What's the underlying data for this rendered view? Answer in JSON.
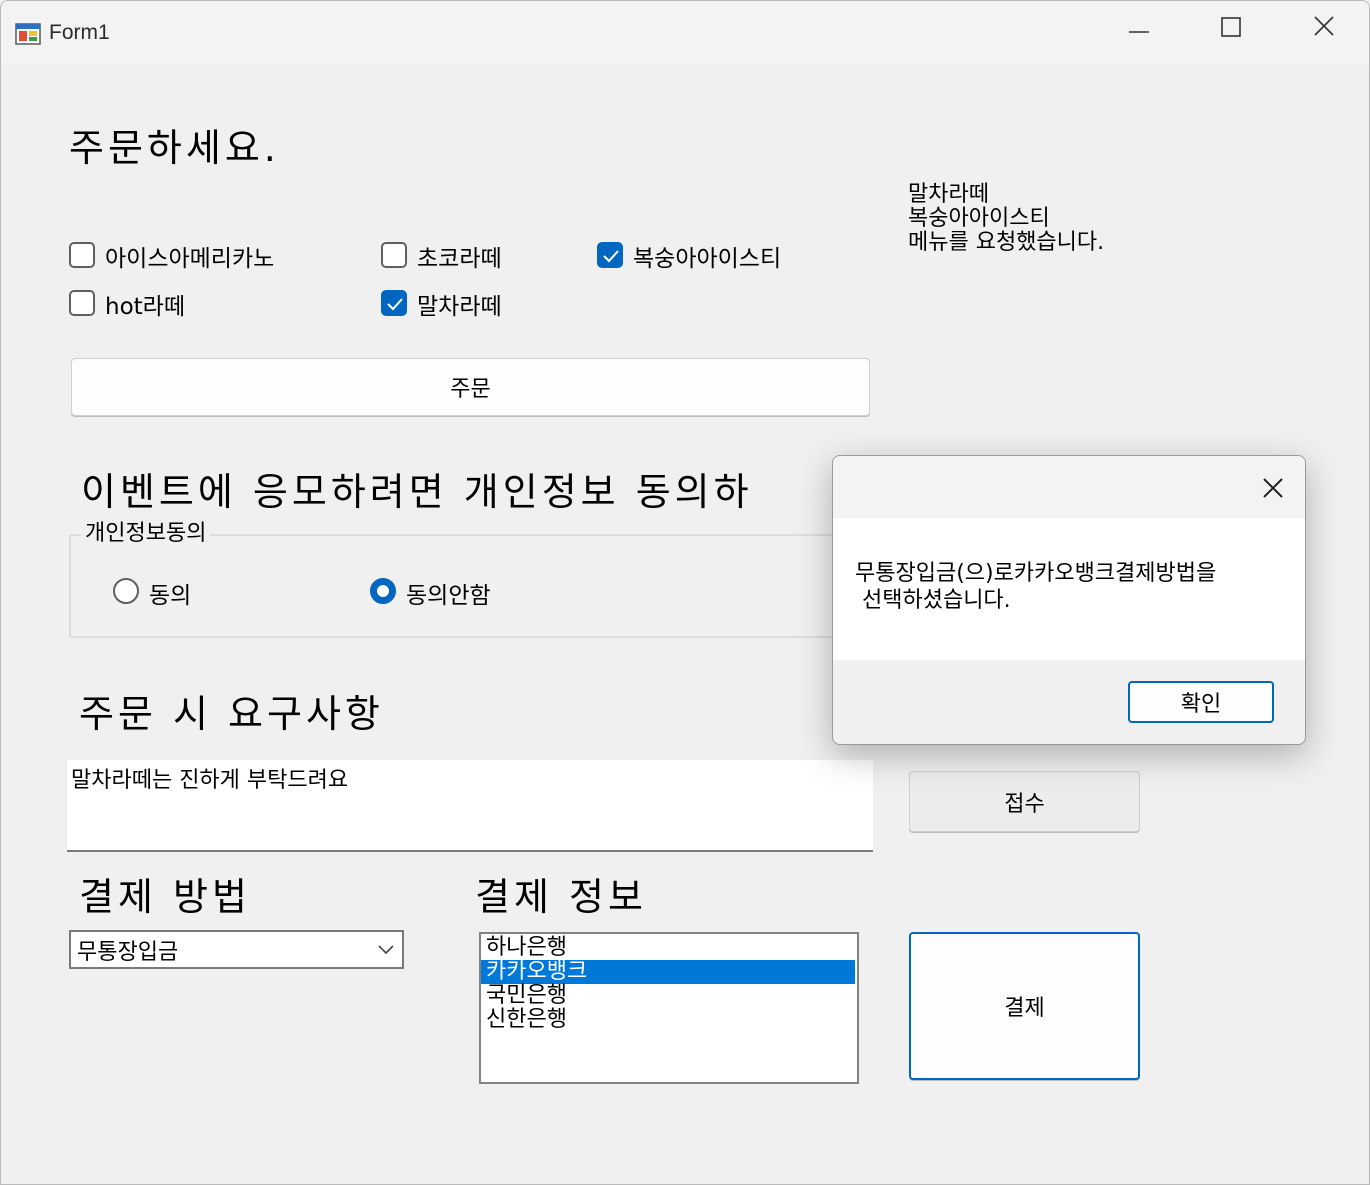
{
  "window": {
    "title": "Form1"
  },
  "heading_order": "주문하세요.",
  "menu": {
    "items": [
      {
        "label": "아이스아메리카노",
        "checked": false
      },
      {
        "label": "초코라떼",
        "checked": false
      },
      {
        "label": "복숭아아이스티",
        "checked": true
      },
      {
        "label": "hot라떼",
        "checked": false
      },
      {
        "label": "말차라떼",
        "checked": true
      }
    ]
  },
  "order_button": "주문",
  "order_result": [
    "말차라떼",
    "복숭아아이스티",
    "메뉴를 요청했습니다."
  ],
  "event_heading": "이벤트에 응모하려면 개인정보 동의하",
  "consent": {
    "legend": "개인정보동의",
    "options": [
      {
        "label": "동의",
        "checked": false
      },
      {
        "label": "동의안함",
        "checked": true
      }
    ]
  },
  "request_heading": "주문 시 요구사항",
  "request_text": "말차라떼는 진하게 부탁드려요",
  "submit_button": "접수",
  "payment_method": {
    "heading": "결제 방법",
    "selected": "무통장입금"
  },
  "payment_info": {
    "heading": "결제 정보",
    "banks": [
      "하나은행",
      "카카오뱅크",
      "국민은행",
      "신한은행"
    ],
    "selected": "카카오뱅크"
  },
  "pay_button": "결제",
  "dialog": {
    "message": "무통장입금(으)로카카오뱅크결제방법을\n 선택하셨습니다.",
    "ok_button": "확인"
  },
  "colors": {
    "accent": "#0067c0",
    "selection": "#0078d7",
    "background": "#f0f0f0"
  }
}
